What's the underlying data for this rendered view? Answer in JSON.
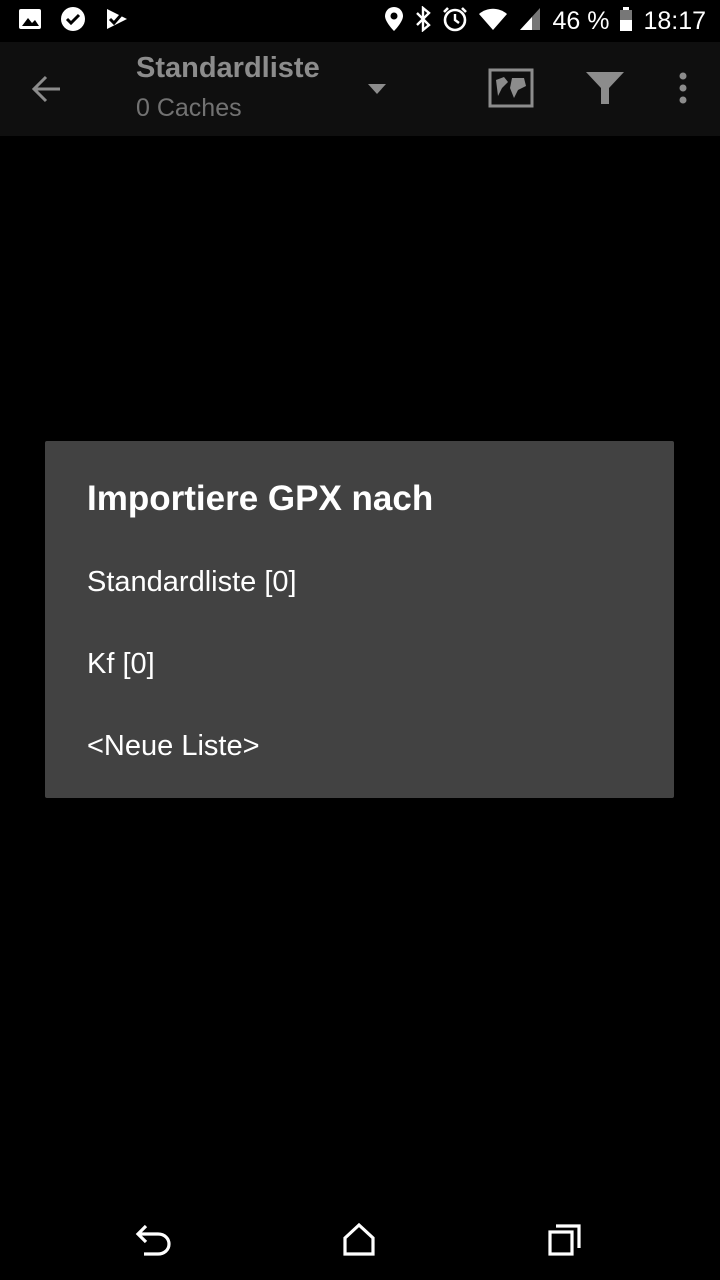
{
  "status_bar": {
    "battery_text": "46 %",
    "time": "18:17",
    "left_icons": [
      "image-icon",
      "check-circle-icon",
      "check-flag-icon"
    ],
    "right_icons": [
      "location-icon",
      "bluetooth-icon",
      "alarm-icon",
      "wifi-icon",
      "signal-icon",
      "battery-icon"
    ]
  },
  "app_bar": {
    "title": "Standardliste",
    "subtitle": "0 Caches",
    "icons": [
      "back-arrow-icon",
      "dropdown-caret-icon",
      "map-icon",
      "filter-icon",
      "more-vert-icon"
    ]
  },
  "dialog": {
    "title": "Importiere GPX nach",
    "items": [
      {
        "label": "Standardliste [0]"
      },
      {
        "label": "Kf [0]"
      },
      {
        "label": "<Neue Liste>"
      }
    ]
  },
  "nav_bar": {
    "icons": [
      "back-icon",
      "home-icon",
      "recents-icon"
    ]
  },
  "colors": {
    "background": "#000000",
    "dialog_background": "#424242",
    "app_bar": "#1c1c1c",
    "text": "#ffffff"
  }
}
